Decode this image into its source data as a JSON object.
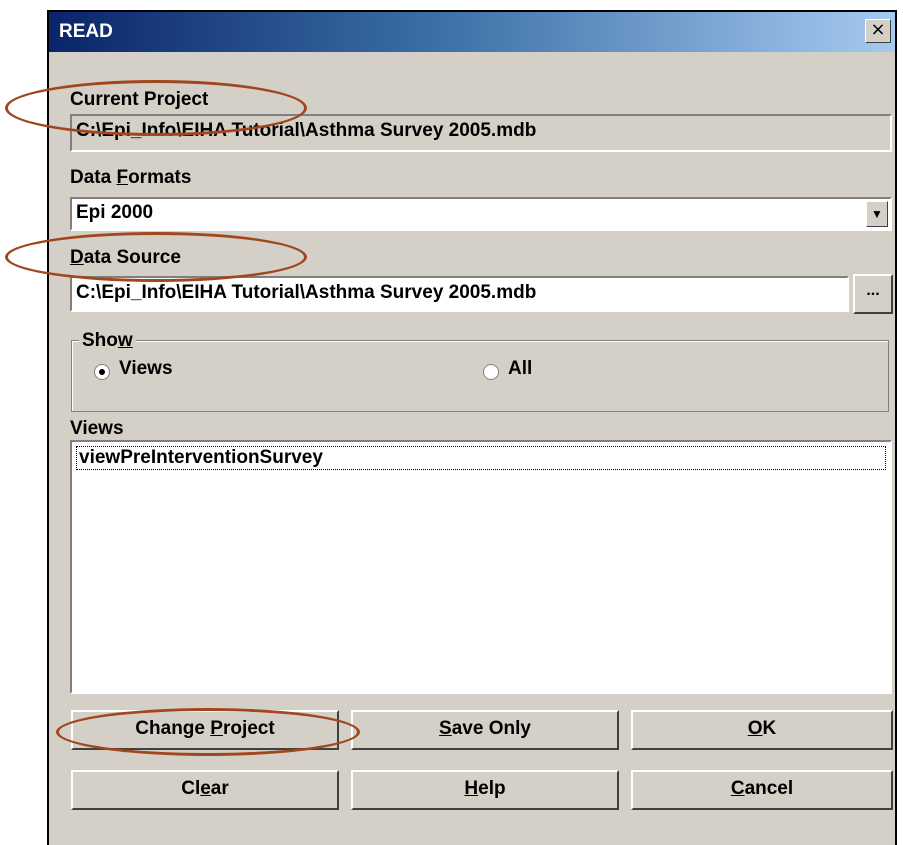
{
  "window": {
    "title": "READ",
    "close_glyph": "×"
  },
  "current_project": {
    "label": "Current Project",
    "value": "C:\\Epi_Info\\EIHA Tutorial\\Asthma Survey 2005.mdb"
  },
  "data_formats": {
    "label_pre": "Data ",
    "label_access": "F",
    "label_post": "ormats",
    "selected": "Epi 2000"
  },
  "data_source": {
    "label_access": "D",
    "label_post": "ata Source",
    "value": "C:\\Epi_Info\\EIHA Tutorial\\Asthma Survey 2005.mdb",
    "browse_label": "..."
  },
  "show": {
    "legend_pre": "Sho",
    "legend_access": "w",
    "options": [
      {
        "label": "Views",
        "selected": true
      },
      {
        "label": "All",
        "selected": false
      }
    ]
  },
  "views": {
    "label": "Views",
    "items": [
      "viewPreInterventionSurvey"
    ]
  },
  "buttons": {
    "change_project": {
      "pre": "Change ",
      "access": "P",
      "post": "roject"
    },
    "save_only": {
      "pre": "",
      "access": "S",
      "post": "ave Only"
    },
    "ok": {
      "pre": "",
      "access": "O",
      "post": "K"
    },
    "clear": {
      "pre": "Cl",
      "access": "e",
      "post": "ar"
    },
    "help": {
      "pre": "",
      "access": "H",
      "post": "elp"
    },
    "cancel": {
      "pre": "",
      "access": "C",
      "post": "ancel"
    }
  },
  "colors": {
    "annotation": "#a0471e",
    "titlebar_start": "#0a246a",
    "titlebar_end": "#a6caf0"
  }
}
